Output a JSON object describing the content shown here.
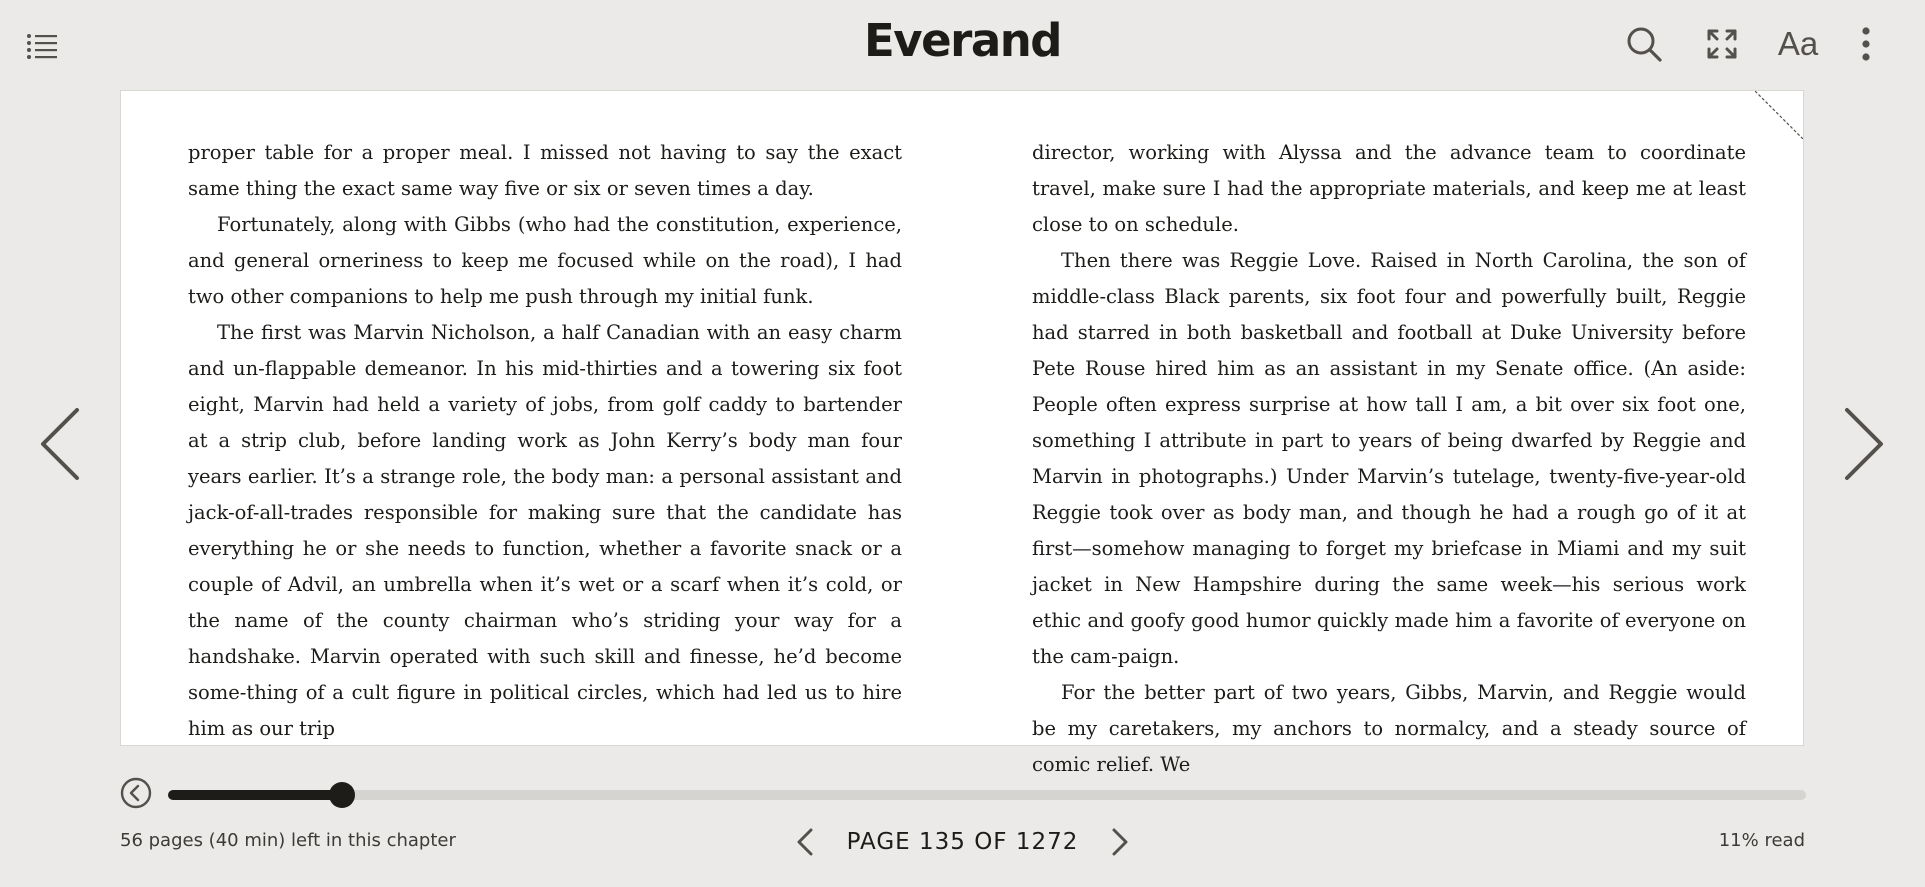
{
  "header": {
    "brand": "Everand",
    "font_settings_label": "Aa",
    "icons": {
      "toc": "list-icon",
      "search": "search-icon",
      "fullscreen": "fullscreen-icon",
      "more": "more-vertical-icon"
    }
  },
  "book": {
    "left_column": [
      "proper table for a proper meal. I missed not having to say the exact same thing the exact same way five or six or seven times a day.",
      "Fortunately, along with Gibbs (who had the constitution, experience, and general orneriness to keep me focused while on the road), I had two other companions to help me push through my initial funk.",
      "The first was Marvin Nicholson, a half Canadian with an easy charm and un-flappable demeanor. In his mid-thirties and a towering six foot eight, Marvin had held a variety of jobs, from golf caddy to bartender at a strip club, before landing work as John Kerry’s body man four years earlier. It’s a strange role, the body man: a personal assistant and jack-of-all-trades responsible for making sure that the candidate has everything he or she needs to function, whether a favorite snack or a couple of Advil, an umbrella when it’s wet or a scarf when it’s cold, or the name of the county chairman who’s striding your way for a handshake. Marvin operated with such skill and finesse, he’d become some-thing of a cult figure in political circles, which had led us to hire him as our trip"
    ],
    "right_column": [
      "director, working with Alyssa and the advance team to coordinate travel, make sure I had the appropriate materials, and keep me at least close to on schedule.",
      "Then there was Reggie Love. Raised in North Carolina, the son of middle-class Black parents, six foot four and powerfully built, Reggie had starred in both basketball and football at Duke University before Pete Rouse hired him as an assistant in my Senate office. (An aside: People often express surprise at how tall I am, a bit over six foot one, something I attribute in part to years of being dwarfed by Reggie and Marvin in photographs.) Under Marvin’s tutelage, twenty-five-year-old Reggie took over as body man, and though he had a rough go of it at first—somehow managing to forget my briefcase in Miami and my suit jacket in New Hampshire during the same week—his serious work ethic and goofy good humor quickly made him a favorite of everyone on the cam-paign.",
      "For the better part of two years, Gibbs, Marvin, and Reggie would be my caretakers, my anchors to normalcy, and a steady source of comic relief. We"
    ]
  },
  "navigation": {
    "prev_icon": "chevron-left-icon",
    "next_icon": "chevron-right-icon"
  },
  "progress": {
    "fraction": 0.106,
    "back_icon": "circle-chevron-left-icon"
  },
  "footer": {
    "chapter_remaining": "56 pages (40 min) left in this chapter",
    "page_label": "PAGE 135 OF 1272",
    "read_percent": "11% read"
  },
  "colors": {
    "background": "#ebeae8",
    "page": "#ffffff",
    "ink": "#1e1c19",
    "icon": "#54514c",
    "track": "#d6d4d0"
  }
}
